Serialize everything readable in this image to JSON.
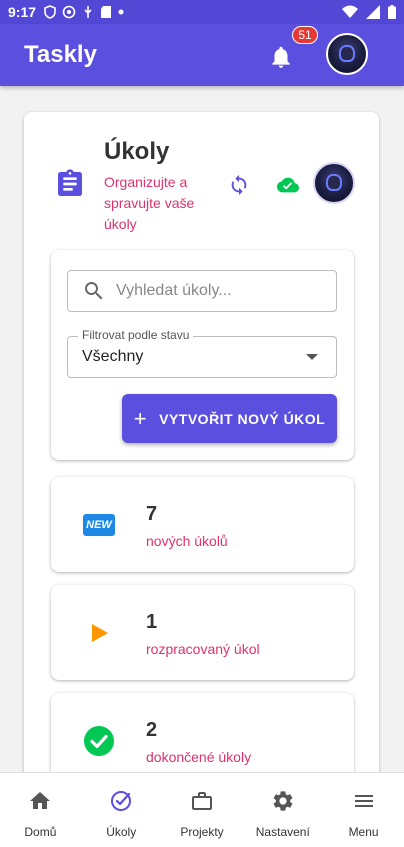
{
  "status_bar": {
    "time": "9:17"
  },
  "app_bar": {
    "title": "Taskly",
    "notification_count": "51"
  },
  "header": {
    "title": "Úkoly",
    "subtitle": "Organizujte a spravujte vaše úkoly"
  },
  "search": {
    "placeholder": "Vyhledat úkoly..."
  },
  "filter": {
    "label": "Filtrovat podle stavu",
    "selected": "Všechny"
  },
  "create_button": {
    "label": "VYTVOŘIT NOVÝ ÚKOL"
  },
  "stats": [
    {
      "icon": "new-icon",
      "badge_text": "NEW",
      "count": "7",
      "label": "nových úkolů"
    },
    {
      "icon": "play-icon",
      "count": "1",
      "label": "rozpracovaný úkol"
    },
    {
      "icon": "check-circle-icon",
      "count": "2",
      "label": "dokončené úkoly"
    }
  ],
  "bottom_nav": [
    {
      "icon": "home-icon",
      "label": "Domů"
    },
    {
      "icon": "tasks-icon",
      "label": "Úkoly",
      "active": true
    },
    {
      "icon": "briefcase-icon",
      "label": "Projekty"
    },
    {
      "icon": "settings-icon",
      "label": "Nastavení"
    },
    {
      "icon": "menu-icon",
      "label": "Menu"
    }
  ],
  "colors": {
    "primary": "#5b4fe0",
    "accent_pink": "#e0316e",
    "success": "#00c853",
    "warning": "#ff9800",
    "badge_red": "#e53935"
  }
}
